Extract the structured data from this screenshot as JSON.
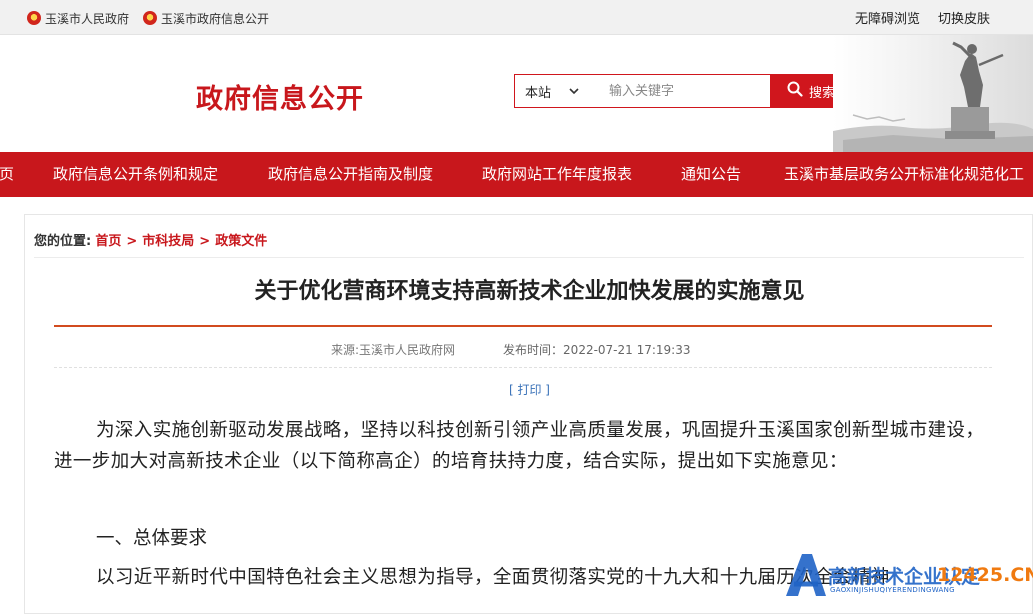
{
  "topbar": {
    "left_links": [
      "玉溪市人民政府",
      "玉溪市政府信息公开"
    ],
    "accessibility": "无障碍浏览",
    "skin": "切换皮肤"
  },
  "header": {
    "title": "政府信息公开",
    "search": {
      "scope_value": "本站",
      "placeholder": "输入关键字",
      "button_label": "搜索"
    }
  },
  "nav": {
    "items": [
      "页",
      "政府信息公开条例和规定",
      "政府信息公开指南及制度",
      "政府网站工作年度报表",
      "通知公告",
      "玉溪市基层政务公开标准化规范化工"
    ]
  },
  "breadcrumb": {
    "label": "您的位置:",
    "items": [
      "首页",
      "市科技局",
      "政策文件"
    ],
    "separator": ">"
  },
  "article": {
    "title": "关于优化营商环境支持高新技术企业加快发展的实施意见",
    "source": "来源:玉溪市人民政府网",
    "published": "发布时间：2022-07-21 17:19:33",
    "print": "[ 打印 ]",
    "paragraphs": [
      "为深入实施创新驱动发展战略，坚持以科技创新引领产业高质量发展，巩固提升玉溪国家创新型城市建设，进一步加大对高新技术企业（以下简称高企）的培育扶持力度，结合实际，提出如下实施意见：",
      "一、总体要求",
      "以习近平新时代中国特色社会主义思想为指导，全面贯彻落实党的十九大和十九届历次全会精神"
    ]
  },
  "watermark": {
    "text": "高新技术企业认定",
    "domain": "12425.CN",
    "pinyin": "GAOXINJISHUQIYERENDINGWANG"
  },
  "colors": {
    "brand_red": "#c8171c",
    "rule_orange": "#d24b1f",
    "link_blue": "#3a72b8"
  }
}
